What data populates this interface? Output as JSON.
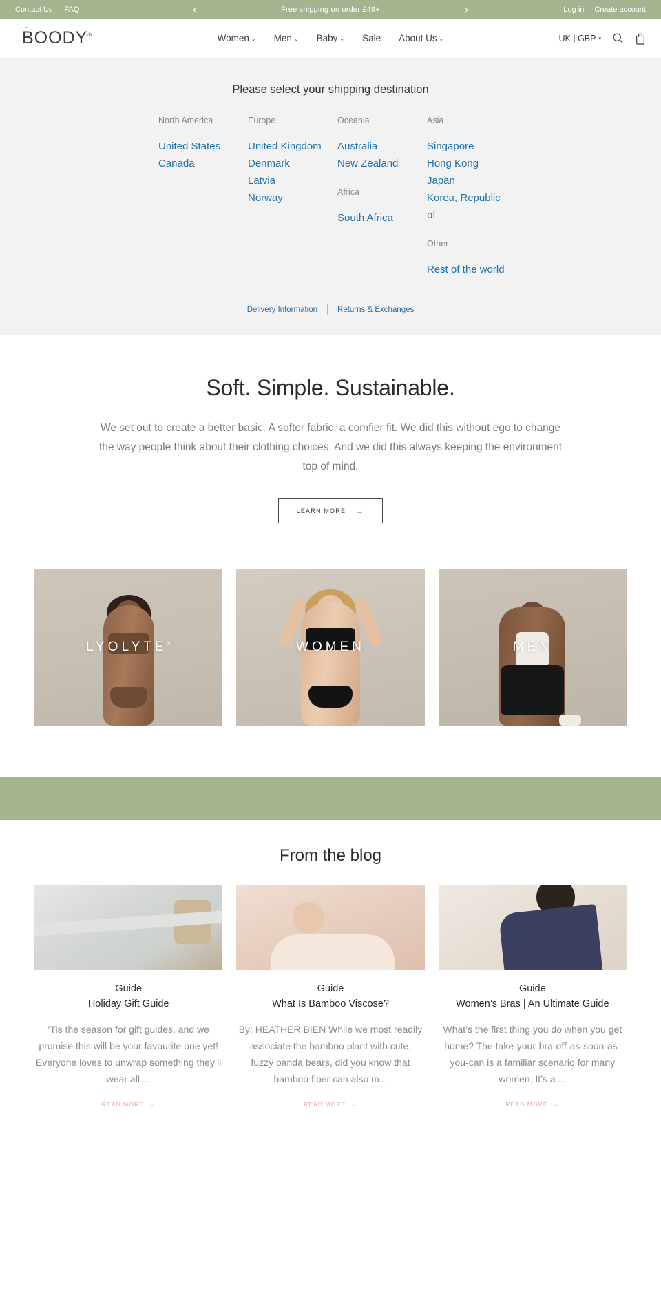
{
  "announcement": {
    "links_left": [
      {
        "label": "Contact Us",
        "name": "contact-us-link"
      },
      {
        "label": "FAQ",
        "name": "faq-link"
      }
    ],
    "message": "Free shipping on order £49+",
    "prev_icon": "chevron-left-icon",
    "next_icon": "chevron-right-icon",
    "prev_glyph": "‹",
    "next_glyph": "›",
    "links_right": [
      {
        "label": "Log in",
        "name": "login-link"
      },
      {
        "label": "Create account",
        "name": "create-account-link"
      }
    ],
    "background": "#a3b48e"
  },
  "header": {
    "logo_text": "BOODY",
    "logo_tick": "ˋ",
    "logo_reg": "®",
    "nav": [
      {
        "label": "Women",
        "has_caret": true
      },
      {
        "label": "Men",
        "has_caret": true
      },
      {
        "label": "Baby",
        "has_caret": true
      },
      {
        "label": "Sale",
        "has_caret": false
      },
      {
        "label": "About Us",
        "has_caret": true
      }
    ],
    "locale": "UK | GBP",
    "caret_glyph": "⌄",
    "search_icon": "search-icon",
    "cart_icon": "shopping-bag-icon"
  },
  "shipping": {
    "title": "Please select your shipping destination",
    "columns": [
      {
        "groups": [
          {
            "label": "North America",
            "countries": [
              "United States",
              "Canada"
            ]
          }
        ]
      },
      {
        "groups": [
          {
            "label": "Europe",
            "countries": [
              "United Kingdom",
              "Denmark",
              "Latvia",
              "Norway"
            ]
          }
        ]
      },
      {
        "groups": [
          {
            "label": "Oceania",
            "countries": [
              "Australia",
              "New Zealand"
            ]
          },
          {
            "label": "Africa",
            "countries": [
              "South Africa"
            ]
          }
        ]
      },
      {
        "groups": [
          {
            "label": "Asia",
            "countries": [
              "Singapore",
              "Hong Kong",
              "Japan",
              "Korea, Republic of"
            ]
          },
          {
            "label": "Other",
            "countries": [
              "Rest of the world"
            ]
          }
        ]
      }
    ],
    "footer_links": [
      {
        "label": "Delivery Information"
      },
      {
        "label": "Returns & Exchanges"
      }
    ]
  },
  "intro": {
    "heading": "Soft. Simple. Sustainable.",
    "body": "We set out to create a better basic. A softer fabric, a comfier fit. We did this without ego to change the way people think about their clothing choices. And we did this always keeping the environment top of mind.",
    "cta_label": "LEARN MORE",
    "cta_arrow": "→"
  },
  "tiles": [
    {
      "label": "LYOLYTE",
      "reg": "®",
      "name": "category-tile-lyolyte"
    },
    {
      "label": "WOMEN",
      "reg": "",
      "name": "category-tile-women"
    },
    {
      "label": "MEN",
      "reg": "",
      "name": "category-tile-men"
    }
  ],
  "blog": {
    "heading": "From the blog",
    "read_more_label": "READ MORE",
    "read_more_arrow": "→",
    "posts": [
      {
        "category": "Guide",
        "title": "Holiday Gift Guide",
        "excerpt": "‘Tis the season for gift guides, and we promise this will be your favourite one yet! Everyone loves to unwrap something they’ll wear all ..."
      },
      {
        "category": "Guide",
        "title": "What Is Bamboo Viscose?",
        "excerpt": "By: HEATHER BIEN While we most readily associate the bamboo plant with cute, fuzzy panda bears, did you know that bamboo fiber can also m..."
      },
      {
        "category": "Guide",
        "title": "Women’s Bras | An Ultimate Guide",
        "excerpt": "What’s the first thing you do when you get home? The take-your-bra-off-as-soon-as-you-can is a familiar scenario for many women. It’s a ..."
      }
    ]
  },
  "colors": {
    "brand_green": "#a3b48e",
    "link_blue": "#1f73ad",
    "accent_peach": "#e5a99a"
  }
}
